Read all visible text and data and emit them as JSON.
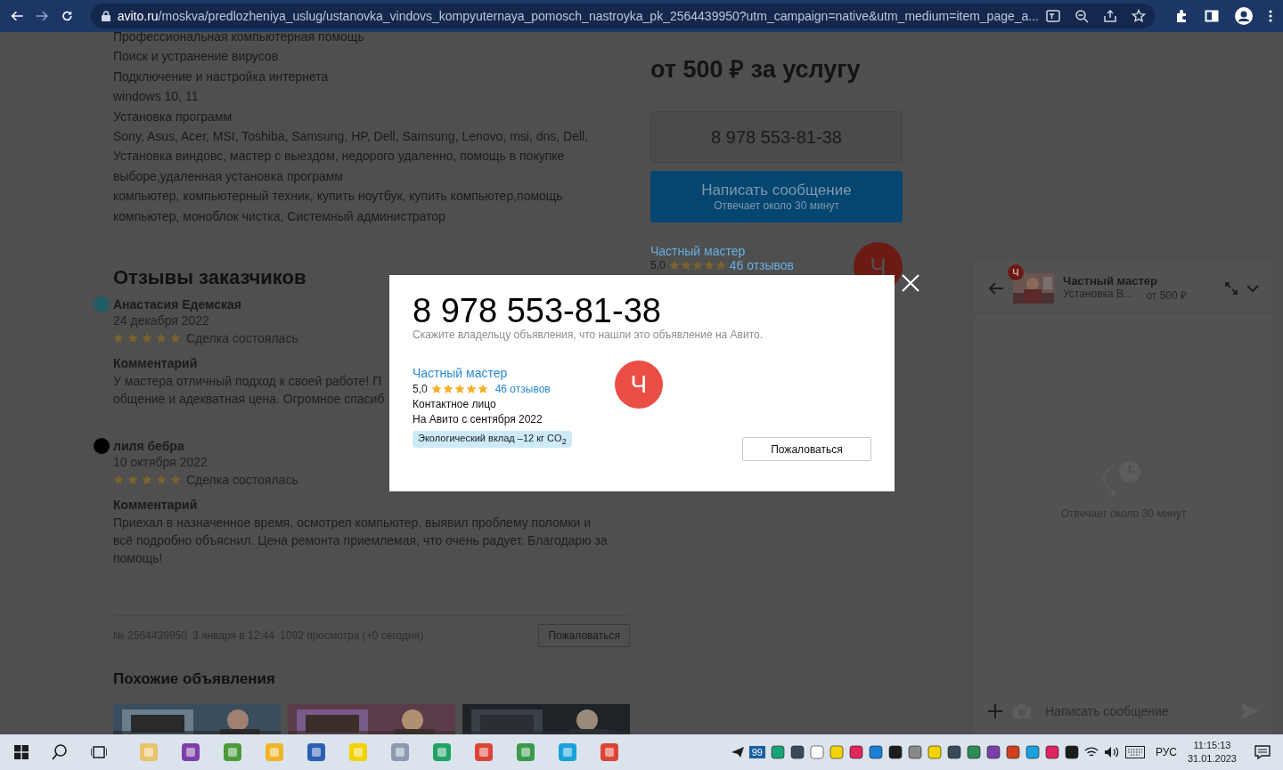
{
  "browser": {
    "domain": "avito.ru",
    "path": "/moskva/predlozheniya_uslug/ustanovka_vindovs_kompyuternaya_pomosch_nastroyka_pk_2564439950?utm_campaign=native&utm_medium=item_page_a..."
  },
  "description_lines": [
    "Профессиональная компьютерная помощь",
    "Поиск и устранение вирусов",
    "Подключение и настройка интернета",
    "windows 10, 11",
    "Установка программ",
    "Sony, Asus, Acer, MSI, Toshiba, Samsung, HP, Dell, Samsung, Lenovo, msi, dns, Dell,",
    "Установка виндовс, мастер с выездом, недорого удаленно, помощь в покупке",
    "выборе,удаленная установка программ",
    "компьютер, компьютерный техник, купить ноутбук, купить компьютер,помощь",
    "компьютер, моноблок чистка, Системный администратор"
  ],
  "price": "от **500 ₽** за услугу",
  "phone_button": "8 978 553-81-38",
  "message_button": {
    "label": "Написать сообщение",
    "sub": "Отвечает около 30 минут"
  },
  "seller_card": {
    "name": "Частный мастер",
    "rating": "5,0",
    "stars": 5,
    "reviews": "46 отзывов",
    "avatar_letter": "Ч"
  },
  "reviews": {
    "title": "Отзывы заказчиков",
    "items": [
      {
        "author": "Анастасия Едемская",
        "color": "#1f5c66",
        "date": "24 декабря 2022",
        "stars": 5,
        "status": "Сделка состоялась",
        "comment_label": "Комментарий",
        "comment_lines": [
          "У мастера отличный подход к своей работе! П",
          "общение и адекватная цена. Огромное спасиб"
        ]
      },
      {
        "author": "лиля бебра",
        "color": "#000000",
        "date": "10 октября 2022",
        "stars": 5,
        "status": "Сделка состоялась",
        "comment_label": "Комментарий",
        "comment_lines": [
          "Приехал в назначенное время, осмотрел компьютер, выявил проблему поломки и",
          "всё подробно объяснил. Цена ремонта приемлемая, что очень радует. Благодарю за",
          "помощь!"
        ]
      }
    ]
  },
  "ad_meta": {
    "number": "№ 2564439950",
    "date": "3 января в 12:44",
    "views": "1092 просмотра (+0 сегодня)",
    "report_button": "Пожаловаться"
  },
  "similar": {
    "title": "Похожие объявления"
  },
  "modal": {
    "phone": "8 978 553-81-38",
    "hint": "Скажите владельцу объявления, что нашли это объявление на Авито.",
    "seller_name": "Частный мастер",
    "rating": "5,0",
    "stars": 5,
    "reviews": "46 отзывов",
    "contact": "Контактное лицо",
    "since": "На Авито с сентября 2022",
    "eco": "Экологический вклад –12 кг CO$_{2}$",
    "avatar_letter": "Ч",
    "report_button": "Пожаловаться"
  },
  "chat": {
    "badge": "Ч",
    "title": "Частный мастер",
    "subtitle": "Установка В...",
    "price": "· от 500 ₽",
    "status": "Отвечает около 30 минут",
    "input_placeholder": "Написать сообщение"
  },
  "taskbar": {
    "badge": "99",
    "language": "РУС",
    "time": "11:15:13",
    "date": "31.01.2023"
  }
}
